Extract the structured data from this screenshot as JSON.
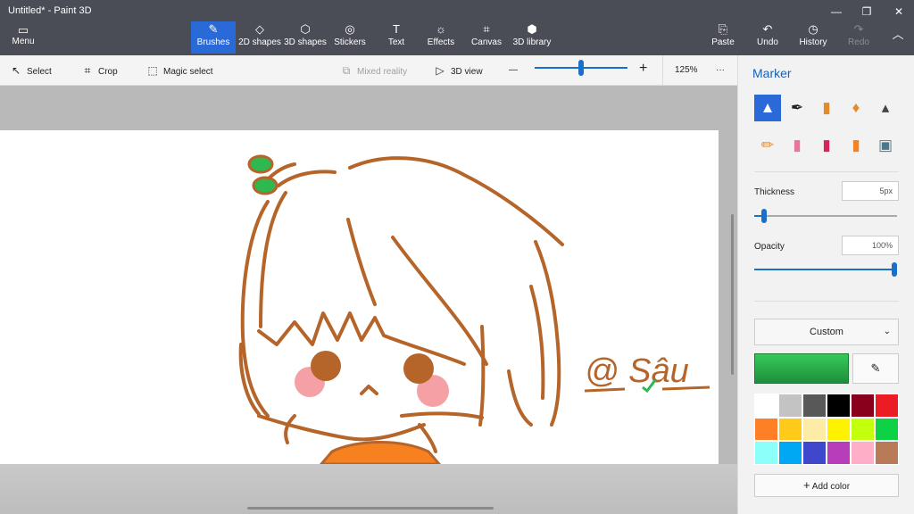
{
  "window": {
    "title": "Untitled* - Paint 3D",
    "controls": [
      "—",
      "❐",
      "✕"
    ]
  },
  "menu": {
    "label": "Menu",
    "icon": "folder-icon"
  },
  "ribbon": {
    "tabs": [
      {
        "label": "Brushes",
        "icon": "brush-icon",
        "glyph": "✎"
      },
      {
        "label": "2D shapes",
        "icon": "shapes-2d-icon",
        "glyph": "◇"
      },
      {
        "label": "3D shapes",
        "icon": "cube-icon",
        "glyph": "⬡"
      },
      {
        "label": "Stickers",
        "icon": "sticker-icon",
        "glyph": "◎"
      },
      {
        "label": "Text",
        "icon": "text-icon",
        "glyph": "T"
      },
      {
        "label": "Effects",
        "icon": "effects-icon",
        "glyph": "☼"
      },
      {
        "label": "Canvas",
        "icon": "canvas-icon",
        "glyph": "⌗"
      },
      {
        "label": "3D library",
        "icon": "library-icon",
        "glyph": "⬢"
      }
    ],
    "right": [
      {
        "label": "Paste",
        "icon": "paste-icon",
        "glyph": "⎘"
      },
      {
        "label": "Undo",
        "icon": "undo-icon",
        "glyph": "↶"
      },
      {
        "label": "History",
        "icon": "history-icon",
        "glyph": "◷"
      },
      {
        "label": "Redo",
        "icon": "redo-icon",
        "glyph": "↷"
      }
    ],
    "collapse_glyph": "︿"
  },
  "toolbar": {
    "select": "Select",
    "crop": "Crop",
    "magic_select": "Magic select",
    "mixed_reality": "Mixed reality",
    "view3d": "3D view",
    "zoom_minus": "—",
    "zoom_plus": "+",
    "zoom": "125%",
    "more": "···",
    "zoom_level": 0.5
  },
  "canvas": {
    "signature": "@ Sâu"
  },
  "panel": {
    "title": "Marker",
    "brushes": [
      "marker-icon",
      "calligraphy-pen-icon",
      "oil-brush-icon",
      "watercolor-icon",
      "pixel-pen-icon",
      "pencil-icon",
      "eraser-icon",
      "crayon-icon",
      "spray-can-icon",
      "fill-bucket-icon"
    ],
    "thickness_label": "Thickness",
    "thickness_value": "5px",
    "thickness_level": 0.05,
    "opacity_label": "Opacity",
    "opacity_value": "100%",
    "opacity_level": 1.0,
    "color_mode": "Custom",
    "current_color": "#27ae4a",
    "palette": [
      "#ffffff",
      "#c3c3c3",
      "#585858",
      "#000000",
      "#88001b",
      "#ec1c24",
      "#ff7f27",
      "#ffca18",
      "#fdeca6",
      "#fff200",
      "#c4ff0e",
      "#0ed145",
      "#8cfffb",
      "#00a8f3",
      "#3f48cc",
      "#b83dba",
      "#ffaec8",
      "#b97a57"
    ],
    "add_color": "Add color"
  }
}
